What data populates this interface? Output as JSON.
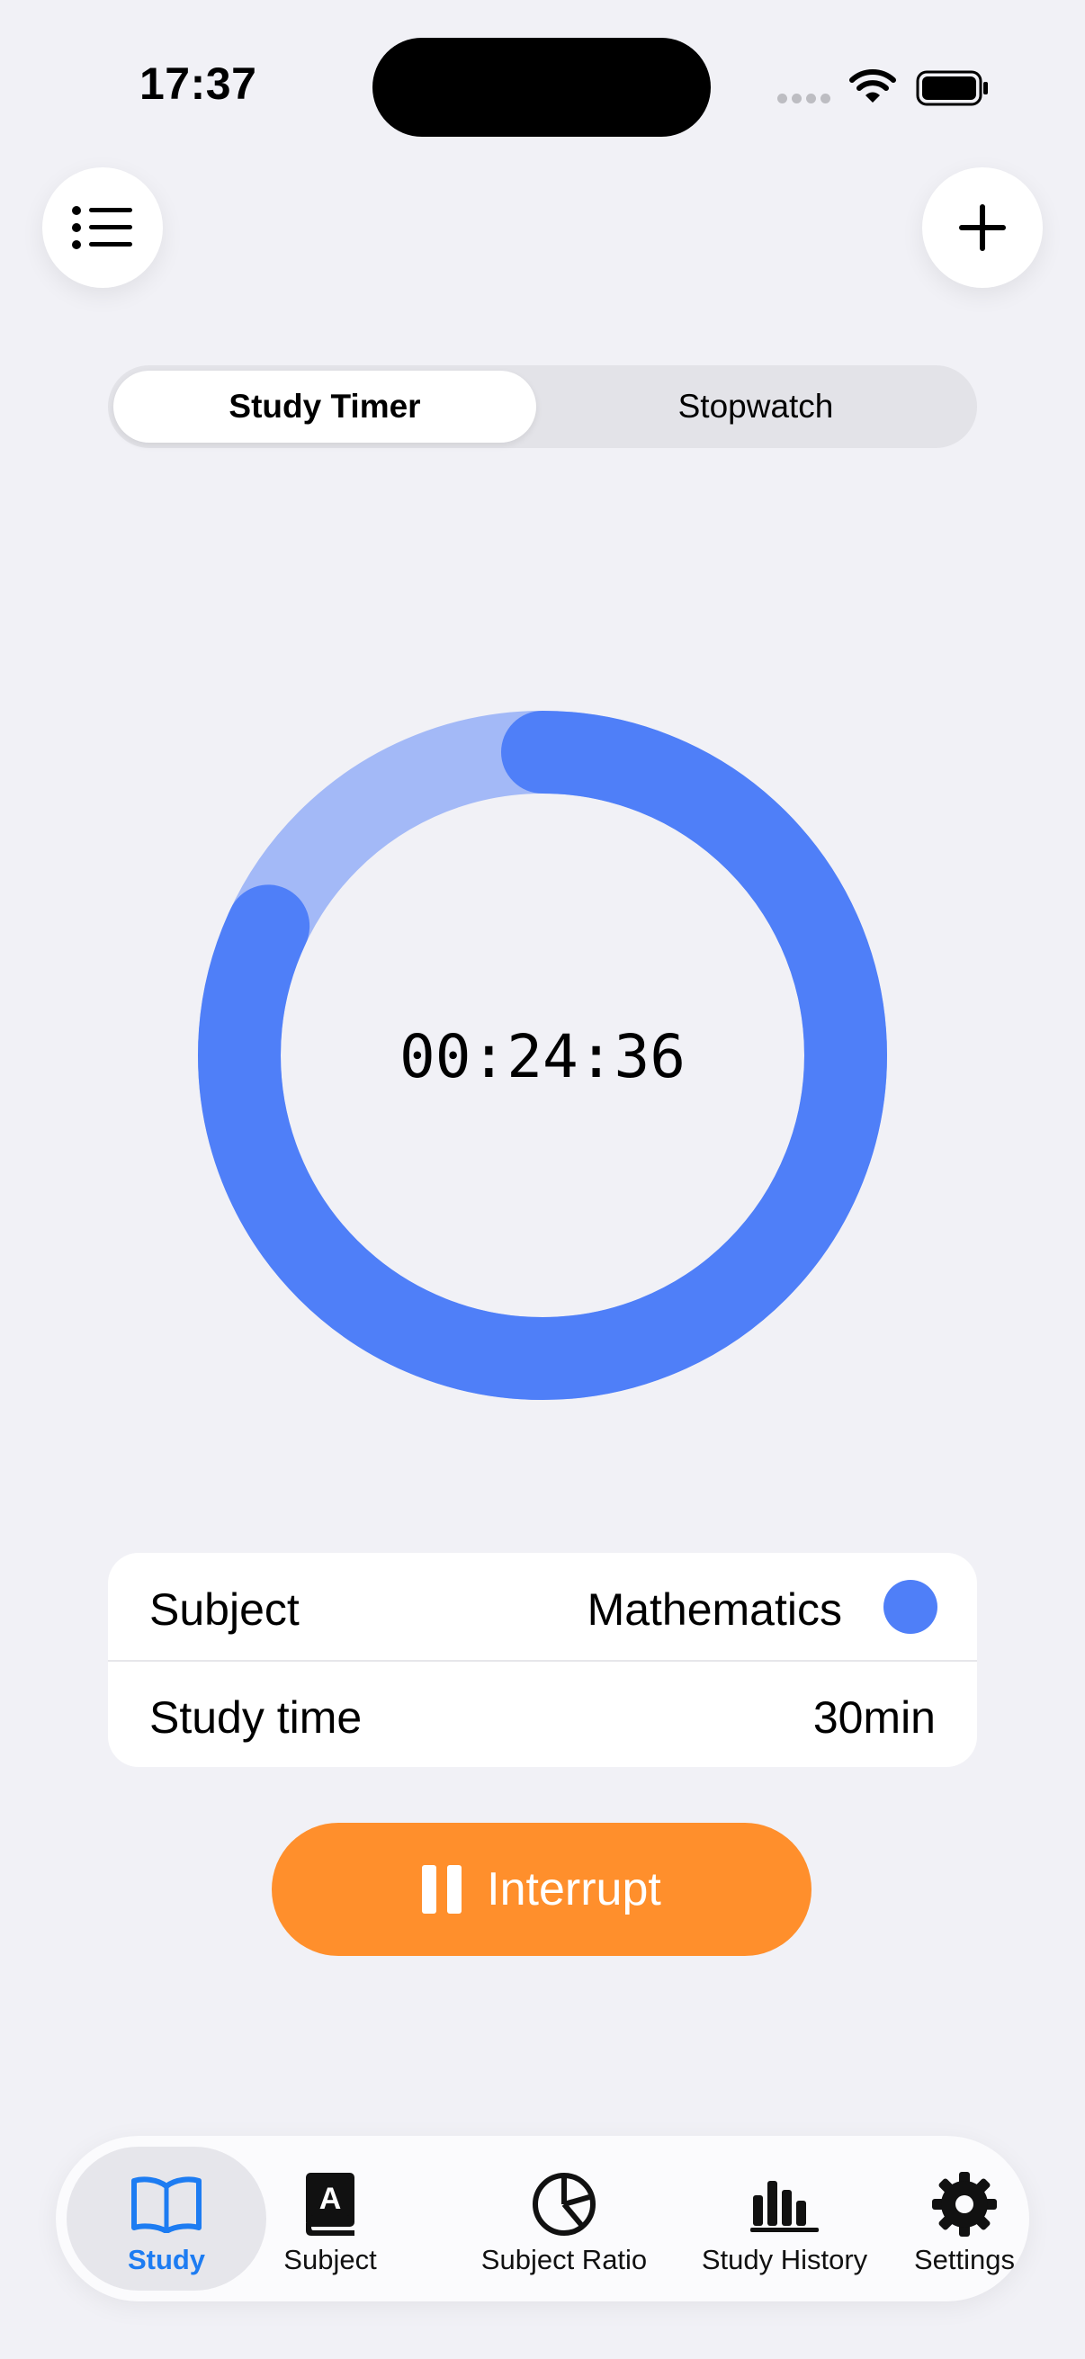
{
  "status_bar": {
    "time": "17:37"
  },
  "segmented": {
    "options": [
      "Study Timer",
      "Stopwatch"
    ],
    "selected": "Study Timer"
  },
  "timer": {
    "display": "00:24:36",
    "progress_fraction": 0.82,
    "ring_color": "#4F7FF8",
    "track_color": "#A3B9F7"
  },
  "info": {
    "subject_label": "Subject",
    "subject_value": "Mathematics",
    "subject_color": "#4F7FF8",
    "time_label": "Study time",
    "time_value": "30min"
  },
  "actions": {
    "interrupt_label": "Interrupt",
    "interrupt_color": "#FF8F2C"
  },
  "tabbar": {
    "active": "Study",
    "accent": "#1D7CF2",
    "tabs": [
      {
        "label": "Study",
        "icon": "book-icon"
      },
      {
        "label": "Subject",
        "icon": "dictionary-icon"
      },
      {
        "label": "Subject Ratio",
        "icon": "pie-chart-icon"
      },
      {
        "label": "Study History",
        "icon": "bar-chart-icon"
      },
      {
        "label": "Settings",
        "icon": "gear-icon"
      }
    ]
  }
}
